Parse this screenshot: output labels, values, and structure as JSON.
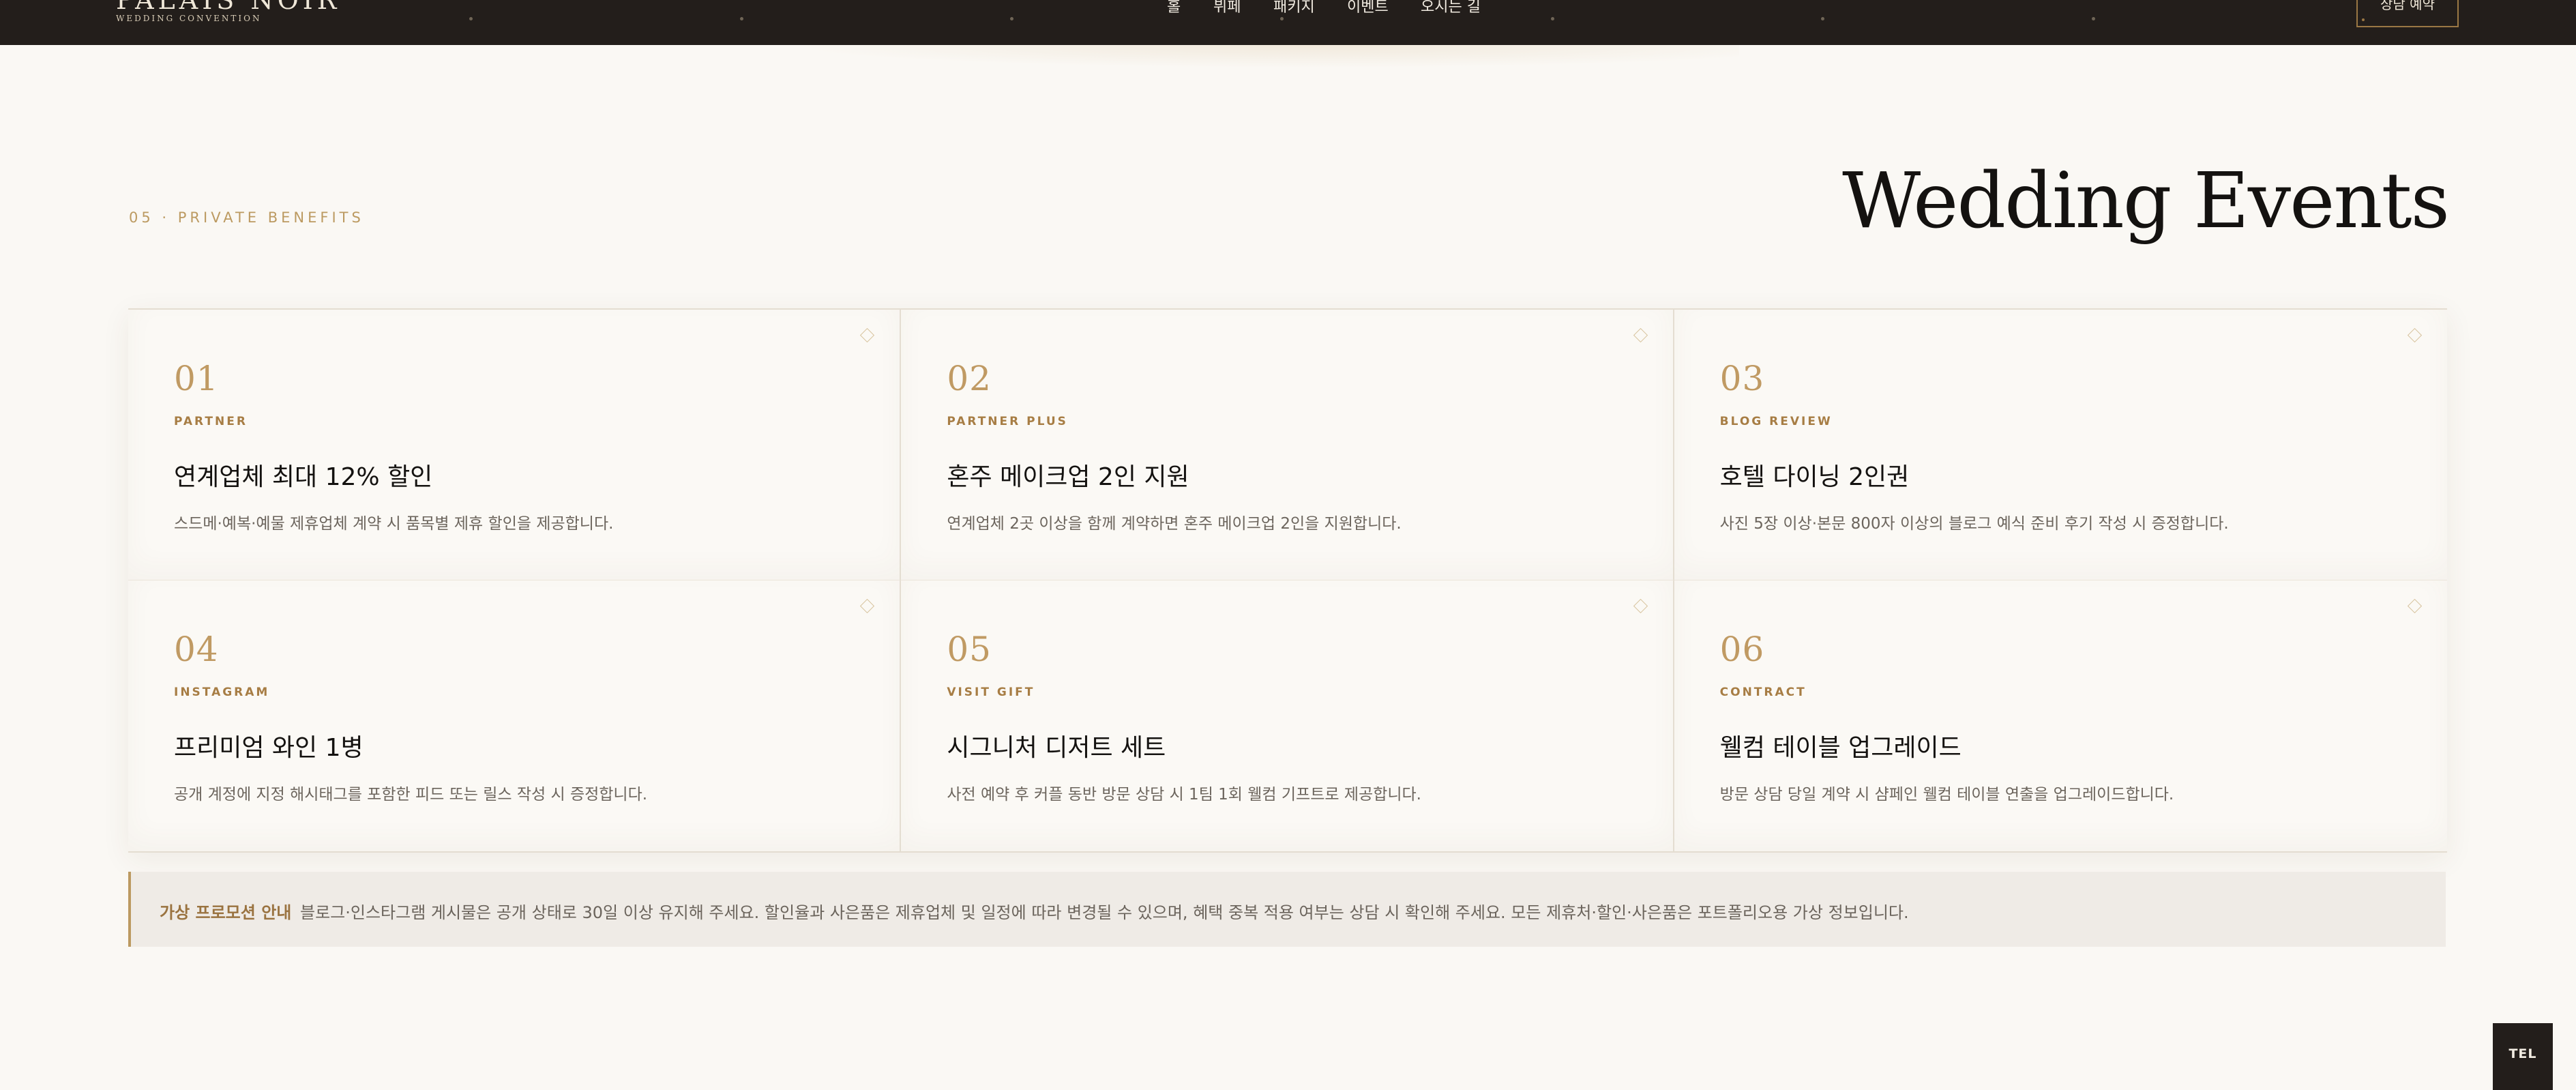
{
  "header": {
    "brand_name": "PALAIS NOIR",
    "brand_subtitle": "WEDDING CONVENTION",
    "nav": [
      "홀",
      "뷔페",
      "패키지",
      "이벤트",
      "오시는 길"
    ],
    "reserve_label": "상담 예약"
  },
  "section": {
    "eyebrow": "05 · PRIVATE BENEFITS",
    "title": "Wedding Events"
  },
  "benefits": [
    {
      "num": "01",
      "tag": "PARTNER",
      "title": "연계업체 최대 12% 할인",
      "desc": "스드메·예복·예물 제휴업체 계약 시 품목별 제휴 할인을 제공합니다."
    },
    {
      "num": "02",
      "tag": "PARTNER PLUS",
      "title": "혼주 메이크업 2인 지원",
      "desc": "연계업체 2곳 이상을 함께 계약하면 혼주 메이크업 2인을 지원합니다."
    },
    {
      "num": "03",
      "tag": "BLOG REVIEW",
      "title": "호텔 다이닝 2인권",
      "desc": "사진 5장 이상·본문 800자 이상의 블로그 예식 준비 후기 작성 시 증정합니다."
    },
    {
      "num": "04",
      "tag": "INSTAGRAM",
      "title": "프리미엄 와인 1병",
      "desc": "공개 계정에 지정 해시태그를 포함한 피드 또는 릴스 작성 시 증정합니다."
    },
    {
      "num": "05",
      "tag": "VISIT GIFT",
      "title": "시그니처 디저트 세트",
      "desc": "사전 예약 후 커플 동반 방문 상담 시 1팀 1회 웰컴 기프트로 제공합니다."
    },
    {
      "num": "06",
      "tag": "CONTRACT",
      "title": "웰컴 테이블 업그레이드",
      "desc": "방문 상담 당일 계약 시 샴페인 웰컴 테이블 연출을 업그레이드합니다."
    }
  ],
  "notice": {
    "label": "가상 프로모션 안내",
    "text": "블로그·인스타그램 게시물은 공개 상태로 30일 이상 유지해 주세요. 할인율과 사은품은 제휴업체 및 일정에 따라 변경될 수 있으며, 혜택 중복 적용 여부는 상담 시 확인해 주세요. 모든 제휴처·할인·사은품은 포트폴리오용 가상 정보입니다."
  },
  "tel_label": "TEL",
  "colors": {
    "accent": "#bc9a61",
    "dark": "#231e1b",
    "background": "#faf8f4"
  }
}
